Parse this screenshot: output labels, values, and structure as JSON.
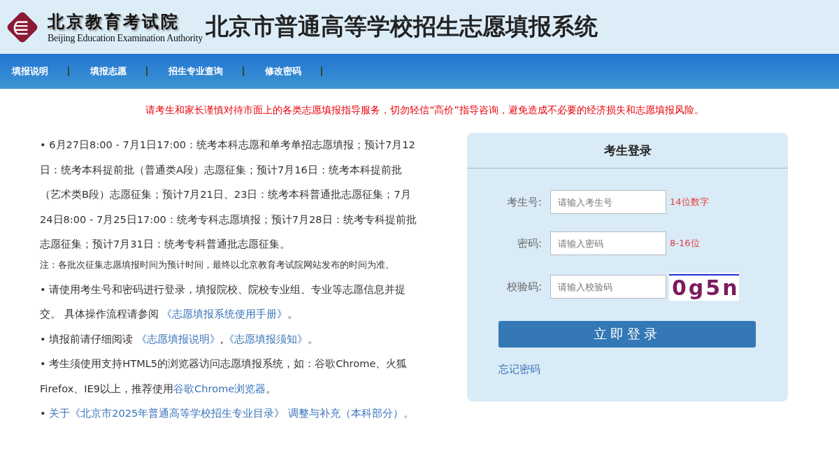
{
  "header": {
    "org_name": "北京教育考试院",
    "org_name_en": "Beijing Education Examination Authority",
    "title": "北京市普通高等学校招生志愿填报系统"
  },
  "nav": [
    {
      "label": "填报说明"
    },
    {
      "label": "填报志愿"
    },
    {
      "label": "招生专业查询"
    },
    {
      "label": "修改密码"
    }
  ],
  "warning": "请考生和家长谨慎对待市面上的各类志愿填报指导服务，切勿轻信“高价”指导咨询，避免造成不必要的经济损失和志愿填报风险。",
  "notices": [
    {
      "kind": "bullet",
      "bullet": "•",
      "segments": [
        {
          "text": "6月27日8:00 - 7月1日17:00：统考本科志愿和单考单招志愿填报；预计7月12日：统考本科提前批（普通类A段）志愿征集；预计7月16日：统考本科提前批（艺术类B段）志愿征集；预计7月21日、23日：统考本科普通批志愿征集；7月24日8:00 - 7月25日17:00：统考专科志愿填报；预计7月28日：统考专科提前批志愿征集；预计7月31日：统考专科普通批志愿征集。",
          "kind": "text"
        }
      ]
    },
    {
      "kind": "note",
      "segments": [
        {
          "text": "注：各批次征集志愿填报时间为预计时间，最终以北京教育考试院网站发布的时间为准。",
          "kind": "text"
        }
      ]
    },
    {
      "kind": "bullet",
      "bullet": "•",
      "segments": [
        {
          "text": "请使用考生号和密码进行登录，填报院校、院校专业组、专业等志愿信息并提交。 具体操作流程请参阅 ",
          "kind": "text"
        },
        {
          "text": "《志愿填报系统使用手册》",
          "kind": "link"
        },
        {
          "text": "。",
          "kind": "text"
        }
      ]
    },
    {
      "kind": "bullet",
      "bullet": "•",
      "segments": [
        {
          "text": "填报前请仔细阅读 ",
          "kind": "text"
        },
        {
          "text": "《志愿填报说明》",
          "kind": "link"
        },
        {
          "text": ",",
          "kind": "text"
        },
        {
          "text": "《志愿填报须知》",
          "kind": "link"
        },
        {
          "text": "。",
          "kind": "text"
        }
      ]
    },
    {
      "kind": "bullet",
      "bullet": "•",
      "segments": [
        {
          "text": "考生须使用支持HTML5的浏览器访问志愿填报系统，如：谷歌Chrome、火狐Firefox、IE9以上，推荐使用",
          "kind": "text"
        },
        {
          "text": "谷歌Chrome浏览器",
          "kind": "link"
        },
        {
          "text": "。",
          "kind": "text"
        }
      ]
    },
    {
      "kind": "bullet",
      "bullet": "•",
      "segments": [
        {
          "text": "关于《北京市2025年普通高等学校招生专业目录》 调整与补充（本科部分）。",
          "kind": "link"
        }
      ]
    }
  ],
  "login": {
    "title": "考生登录",
    "fields": [
      {
        "label": "考生号:",
        "placeholder": "请输入考生号",
        "hint": "14位数字",
        "kind": "text"
      },
      {
        "label": "密码:",
        "placeholder": "请输入密码",
        "hint": "8-16位",
        "kind": "password"
      },
      {
        "label": "校验码:",
        "placeholder": "请输入校验码",
        "captcha": "0g5n",
        "kind": "captcha"
      }
    ],
    "submit": "立即登录",
    "forgot": "忘记密码"
  }
}
